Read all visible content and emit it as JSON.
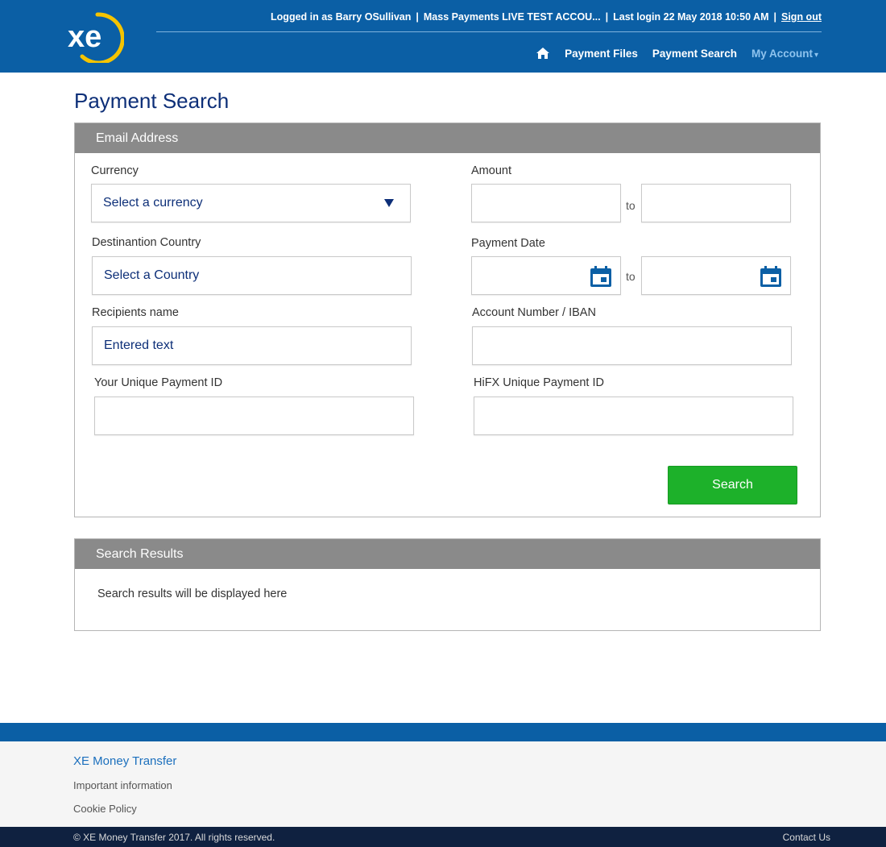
{
  "header": {
    "logo_text": "xe",
    "logged_in_text": "Logged in as Barry OSullivan",
    "account_text": "Mass Payments LIVE TEST ACCOU...",
    "last_login_text": "Last login 22 May 2018 10:50 AM",
    "sign_out_label": "Sign out",
    "separator": "|",
    "nav": {
      "home_icon": "home-icon",
      "payment_files_label": "Payment Files",
      "payment_search_label": "Payment Search",
      "my_account_label": "My Account",
      "my_account_caret": "▾"
    }
  },
  "page": {
    "title": "Payment Search"
  },
  "search_panel": {
    "heading": "Email Address",
    "currency": {
      "label": "Currency",
      "value": "Select a currency"
    },
    "amount": {
      "label": "Amount",
      "to_label": "to",
      "from_value": "",
      "to_value": ""
    },
    "destination_country": {
      "label": "Destinantion Country",
      "value": "Select a Country"
    },
    "payment_date": {
      "label": "Payment Date",
      "to_label": "to",
      "from_value": "",
      "to_value": ""
    },
    "recipients_name": {
      "label": "Recipients name",
      "value": "Entered text"
    },
    "account_number": {
      "label": "Account Number / IBAN",
      "value": ""
    },
    "your_payment_id": {
      "label": "Your Unique Payment ID",
      "value": ""
    },
    "hifx_payment_id": {
      "label": "HiFX Unique Payment ID",
      "value": ""
    },
    "search_button_label": "Search"
  },
  "results_panel": {
    "heading": "Search Results",
    "empty_text": "Search results will be displayed here"
  },
  "footer": {
    "brand": "XE Money Transfer",
    "important_info_label": "Important information",
    "cookie_policy_label": "Cookie Policy",
    "copyright": "© XE Money Transfer 2017. All rights reserved.",
    "contact_label": "Contact Us"
  },
  "colors": {
    "header_blue": "#0b5fa5",
    "title_navy": "#0d2f78",
    "panel_head_gray": "#8a8a8a",
    "search_green": "#1db12a",
    "logo_yellow": "#f5c400",
    "footer_dark": "#0f2140"
  }
}
